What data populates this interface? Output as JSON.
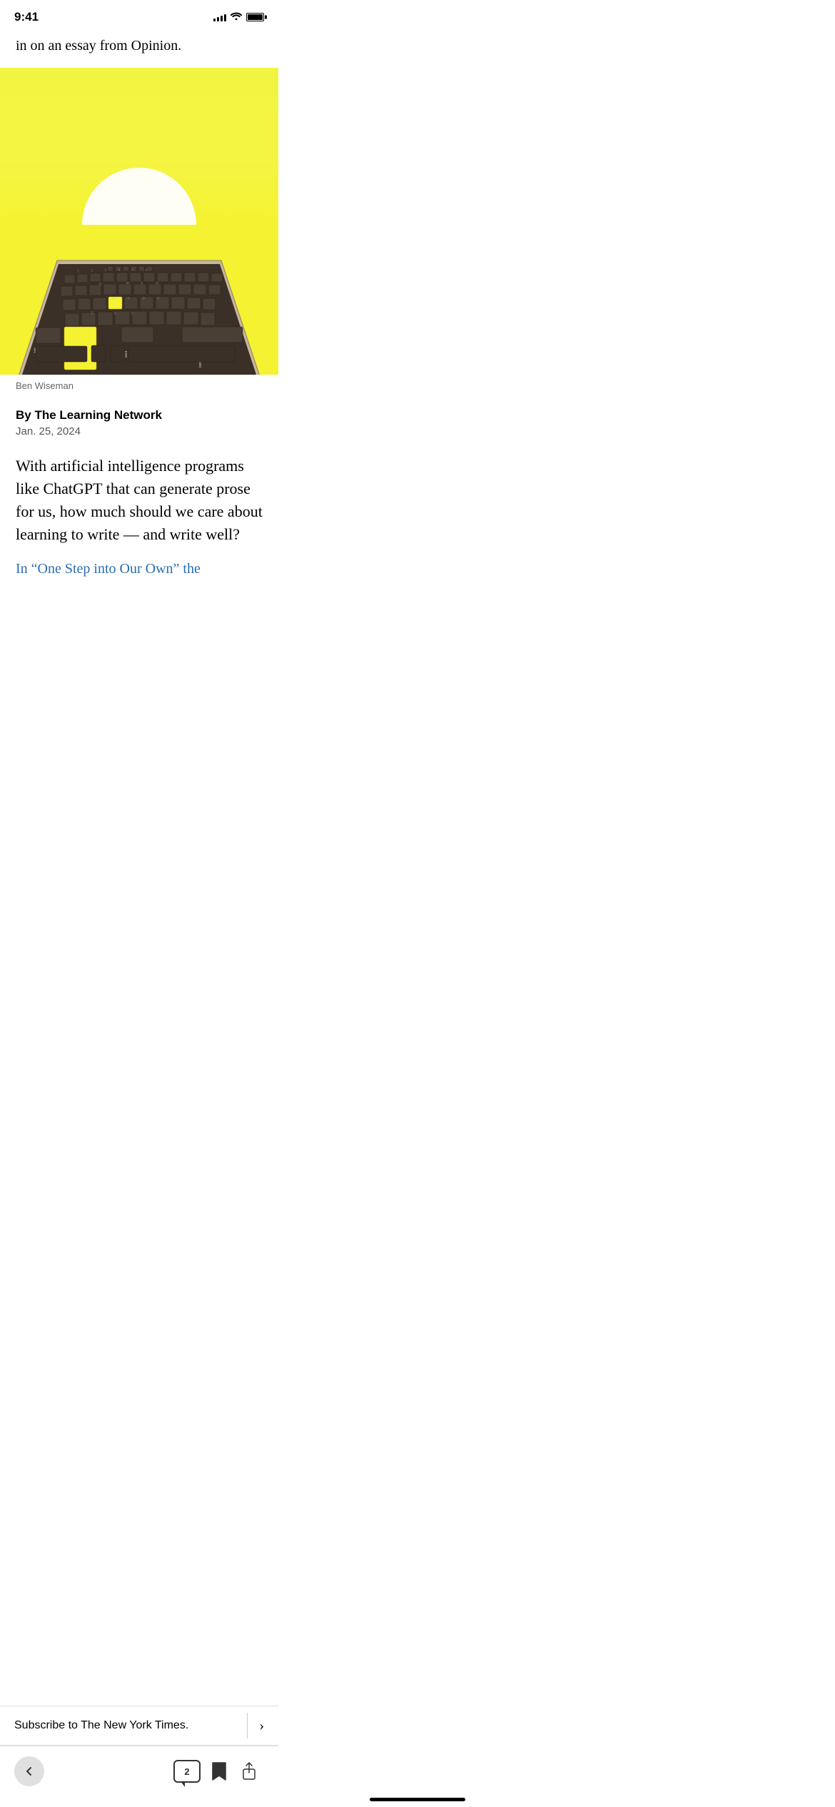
{
  "status": {
    "time": "9:41",
    "signal_bars": [
      4,
      6,
      8,
      10,
      12
    ],
    "battery_level": "100%"
  },
  "intro": {
    "text": "in on an essay from Opinion."
  },
  "hero": {
    "caption": "Ben Wiseman"
  },
  "article": {
    "author": "By The Learning Network",
    "date": "Jan. 25, 2024",
    "deck": "With artificial intelligence programs like ChatGPT that can generate prose for us, how much should we care about learning to write — and write well?",
    "partial_text": "In “One Step into Our Own” the"
  },
  "subscribe": {
    "label": "Subscribe to The New York Times.",
    "chevron": "›"
  },
  "nav": {
    "comment_count": "2"
  }
}
